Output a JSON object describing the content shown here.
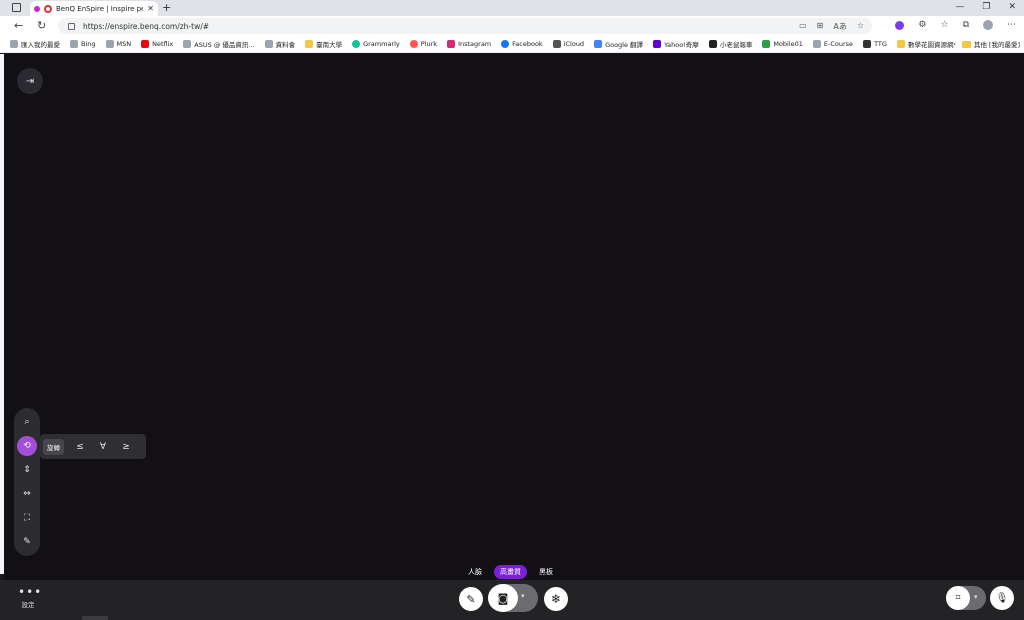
{
  "browser": {
    "tab_title": "BenQ EnSpire | Inspire peo",
    "url": "https://enspire.benq.com/zh-tw/#",
    "bookmarks": [
      "匯入我的最愛",
      "Bing",
      "MSN",
      "Netflix",
      "ASUS @ 優品資訊...",
      "資料會",
      "臺南大學",
      "Grammarly",
      "Plurk",
      "Instagram",
      "Facebook",
      "iCloud",
      "Google 翻譯",
      "Yahoo!奇摩",
      "小老鼠報車",
      "Mobile01",
      "E-Course",
      "TTG",
      "數學花園資源網"
    ],
    "other_favorites": "其他 [我的最愛]"
  },
  "icons": {
    "back": "back-arrow-icon",
    "refresh": "refresh-icon",
    "lock": "lock-icon",
    "exit": "exit-icon",
    "zoom": "zoom-icon",
    "rotate": "rotate-icon",
    "flip_vertical": "flip-vertical-icon",
    "flip_horizontal": "flip-horizontal-icon",
    "crop": "crop-icon",
    "eraser": "eraser-icon",
    "pen": "pen-icon",
    "camera": "camera-icon",
    "freeze": "snowflake-icon",
    "scan": "scan-icon",
    "mic": "microphone-icon"
  },
  "colors": {
    "accent": "#a34ed6",
    "quality_selected": "#7c1fd8",
    "canvas": "#131015",
    "bottombar": "#232326"
  },
  "rotate_panel": {
    "label": "旋轉",
    "options": [
      "≤",
      "∀",
      "≥"
    ]
  },
  "quality": {
    "options": [
      "人臉",
      "高畫質",
      "黑板"
    ],
    "selected": "高畫質"
  },
  "settings_label": "設定"
}
